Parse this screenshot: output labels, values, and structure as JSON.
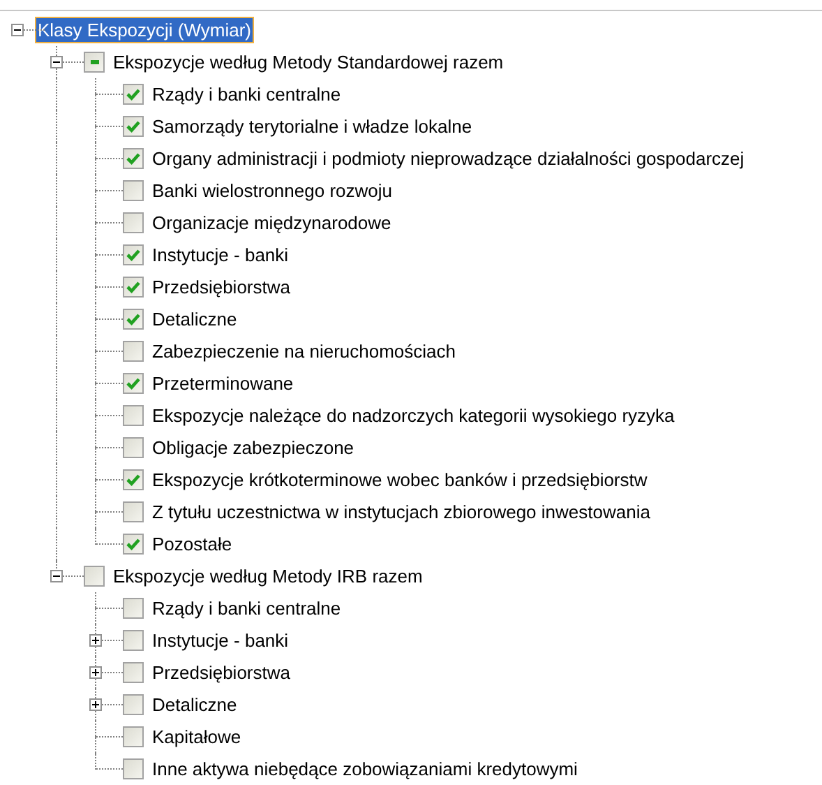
{
  "tree": {
    "label": "Klasy Ekspozycji (Wymiar)",
    "selected": true,
    "expanded": true,
    "children": [
      {
        "label": "Ekspozycje według Metody Standardowej razem",
        "selected": false,
        "checked": true,
        "indeterminate": true,
        "expanded": true,
        "children": [
          {
            "label": "Rządy i banki centralne",
            "selected": false,
            "checked": true,
            "indeterminate": false
          },
          {
            "label": "Samorządy terytorialne i władze lokalne",
            "selected": false,
            "checked": true,
            "indeterminate": false
          },
          {
            "label": "Organy administracji i podmioty nieprowadzące działalności gospodarczej",
            "selected": false,
            "checked": true,
            "indeterminate": false
          },
          {
            "label": "Banki wielostronnego rozwoju",
            "selected": false,
            "checked": false,
            "indeterminate": false
          },
          {
            "label": "Organizacje międzynarodowe",
            "selected": false,
            "checked": false,
            "indeterminate": false
          },
          {
            "label": "Instytucje - banki",
            "selected": false,
            "checked": true,
            "indeterminate": false
          },
          {
            "label": "Przedsiębiorstwa",
            "selected": false,
            "checked": true,
            "indeterminate": false
          },
          {
            "label": "Detaliczne",
            "selected": false,
            "checked": true,
            "indeterminate": false
          },
          {
            "label": "Zabezpieczenie na nieruchomościach",
            "selected": false,
            "checked": false,
            "indeterminate": false
          },
          {
            "label": "Przeterminowane",
            "selected": false,
            "checked": true,
            "indeterminate": false
          },
          {
            "label": "Ekspozycje należące do nadzorczych kategorii wysokiego ryzyka",
            "selected": false,
            "checked": false,
            "indeterminate": false
          },
          {
            "label": "Obligacje zabezpieczone",
            "selected": false,
            "checked": false,
            "indeterminate": false
          },
          {
            "label": "Ekspozycje krótkoterminowe wobec banków i przedsiębiorstw",
            "selected": false,
            "checked": true,
            "indeterminate": false
          },
          {
            "label": "Z tytułu uczestnictwa w instytucjach zbiorowego inwestowania",
            "selected": false,
            "checked": false,
            "indeterminate": false
          },
          {
            "label": "Pozostałe",
            "selected": false,
            "checked": true,
            "indeterminate": false
          }
        ]
      },
      {
        "label": "Ekspozycje według Metody IRB razem",
        "selected": false,
        "checked": false,
        "indeterminate": false,
        "expanded": true,
        "children": [
          {
            "label": "Rządy i banki centralne",
            "selected": false,
            "checked": false,
            "indeterminate": false
          },
          {
            "label": "Instytucje - banki",
            "selected": false,
            "checked": false,
            "indeterminate": false,
            "expanded": false
          },
          {
            "label": "Przedsiębiorstwa",
            "selected": false,
            "checked": false,
            "indeterminate": false,
            "expanded": false
          },
          {
            "label": "Detaliczne",
            "selected": false,
            "checked": false,
            "indeterminate": false,
            "expanded": false
          },
          {
            "label": "Kapitałowe",
            "selected": false,
            "checked": false,
            "indeterminate": false
          },
          {
            "label": "Inne aktywa niebędące zobowiązaniami kredytowymi",
            "selected": false,
            "checked": false,
            "indeterminate": false
          }
        ]
      }
    ]
  }
}
